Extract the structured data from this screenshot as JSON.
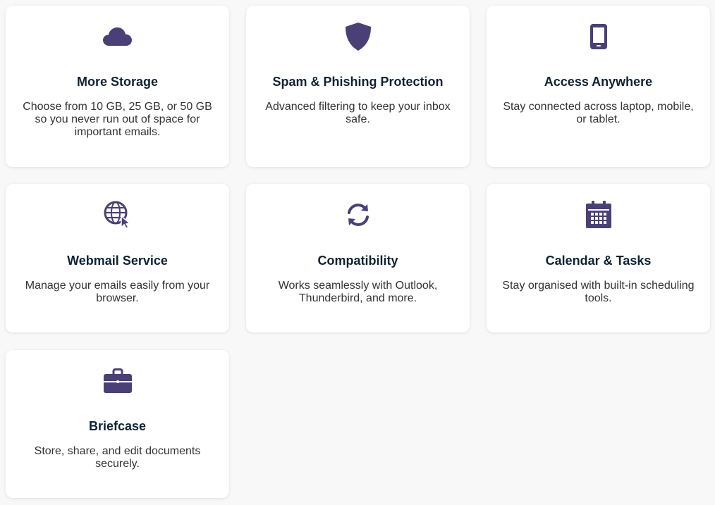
{
  "colors": {
    "accent": "#4b3f78",
    "title": "#0f2233",
    "text": "#333333",
    "background": "#f8f8f8",
    "card": "#ffffff"
  },
  "features": [
    {
      "icon": "cloud-icon",
      "title": "More Storage",
      "description": "Choose from 10 GB, 25 GB, or 50 GB so you never run out of space for important emails."
    },
    {
      "icon": "shield-icon",
      "title": "Spam & Phishing Protection",
      "description": "Advanced filtering to keep your inbox safe."
    },
    {
      "icon": "mobile-phone-icon",
      "title": "Access Anywhere",
      "description": "Stay connected across laptop, mobile, or tablet."
    },
    {
      "icon": "globe-pointer-icon",
      "title": "Webmail Service",
      "description": "Manage your emails easily from your browser."
    },
    {
      "icon": "sync-icon",
      "title": "Compatibility",
      "description": "Works seamlessly with Outlook, Thunderbird, and more."
    },
    {
      "icon": "calendar-icon",
      "title": "Calendar & Tasks",
      "description": "Stay organised with built-in scheduling tools."
    },
    {
      "icon": "briefcase-icon",
      "title": "Briefcase",
      "description": "Store, share, and edit documents securely."
    }
  ]
}
